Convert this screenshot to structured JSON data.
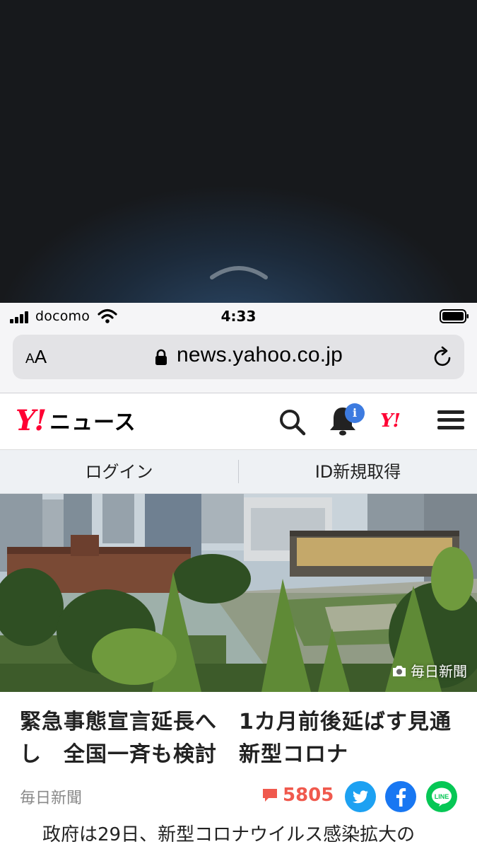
{
  "status_bar": {
    "carrier": "docomo",
    "time": "4:33"
  },
  "browser": {
    "text_size_label_small": "A",
    "text_size_label_large": "A",
    "url": "news.yahoo.co.jp"
  },
  "header": {
    "logo_mark": "Y!",
    "logo_text": "ニュース",
    "notification_badge": "i",
    "yahoo_mark": "Y!"
  },
  "login_bar": {
    "login": "ログイン",
    "register": "ID新規取得"
  },
  "hero": {
    "credit": "毎日新聞"
  },
  "article": {
    "headline": "緊急事態宣言延長へ　1カ月前後延ばす見通し　全国一斉も検討　新型コロナ",
    "source": "毎日新聞",
    "comment_count": "5805",
    "lead": "政府は29日、新型コロナウイルス感染拡大の"
  },
  "colors": {
    "yahoo_red": "#ff0033",
    "comment": "#f0594d",
    "twitter": "#1da1f2",
    "facebook": "#1877f2",
    "line": "#06c755"
  },
  "icons": [
    "chevron-up-icon",
    "signal-icon",
    "wifi-icon",
    "battery-icon",
    "lock-icon",
    "reload-icon",
    "search-icon",
    "bell-icon",
    "menu-icon",
    "camera-icon",
    "comment-icon",
    "twitter-icon",
    "facebook-icon",
    "line-icon"
  ]
}
